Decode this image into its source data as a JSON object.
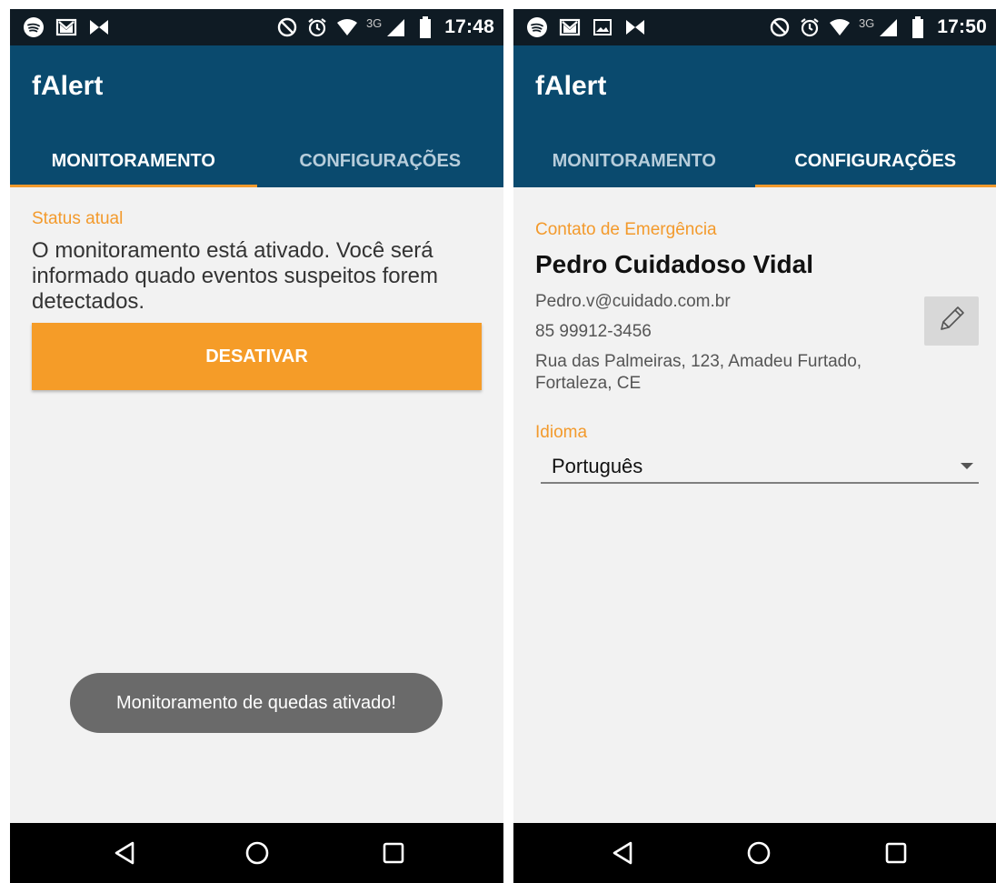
{
  "screens": [
    {
      "status_bar": {
        "left_icons": [
          "spotify-icon",
          "gmail-icon",
          "app-notification-icon"
        ],
        "right_icons": [
          "do-not-disturb-icon",
          "alarm-icon",
          "wifi-icon",
          "signal-icon",
          "battery-icon"
        ],
        "network": "3G",
        "time": "17:48"
      },
      "app_bar": {
        "title": "fAlert",
        "tabs": [
          {
            "label": "MONITORAMENTO",
            "active": true
          },
          {
            "label": "CONFIGURAÇÕES",
            "active": false
          }
        ]
      },
      "monitor": {
        "status_label": "Status atual",
        "status_text": "O monitoramento está ativado. Você será informado quado eventos suspeitos forem detectados.",
        "button_label": "DESATIVAR"
      },
      "toast": "Monitoramento de quedas ativado!",
      "nav_icons": [
        "back-icon",
        "home-icon",
        "recents-icon"
      ]
    },
    {
      "status_bar": {
        "left_icons": [
          "spotify-icon",
          "gmail-icon",
          "image-icon",
          "app-notification-icon"
        ],
        "right_icons": [
          "do-not-disturb-icon",
          "alarm-icon",
          "wifi-icon",
          "signal-icon",
          "battery-icon"
        ],
        "network": "3G",
        "time": "17:50"
      },
      "app_bar": {
        "title": "fAlert",
        "tabs": [
          {
            "label": "MONITORAMENTO",
            "active": false
          },
          {
            "label": "CONFIGURAÇÕES",
            "active": true
          }
        ]
      },
      "settings": {
        "contact_label": "Contato de Emergência",
        "contact_name": "Pedro Cuidadoso Vidal",
        "contact_email": "Pedro.v@cuidado.com.br",
        "contact_phone": "85 99912-3456",
        "contact_address": "Rua das Palmeiras, 123, Amadeu Furtado, Fortaleza, CE",
        "edit_icon": "pencil-icon",
        "language_label": "Idioma",
        "language_value": "Português"
      },
      "nav_icons": [
        "back-icon",
        "home-icon",
        "recents-icon"
      ]
    }
  ],
  "colors": {
    "status_bar": "#0f1b24",
    "app_bar": "#0a4a6e",
    "accent": "#f39a2c",
    "background": "#f2f2f2",
    "toast": "#6a6a6a",
    "nav_bar": "#000000"
  }
}
